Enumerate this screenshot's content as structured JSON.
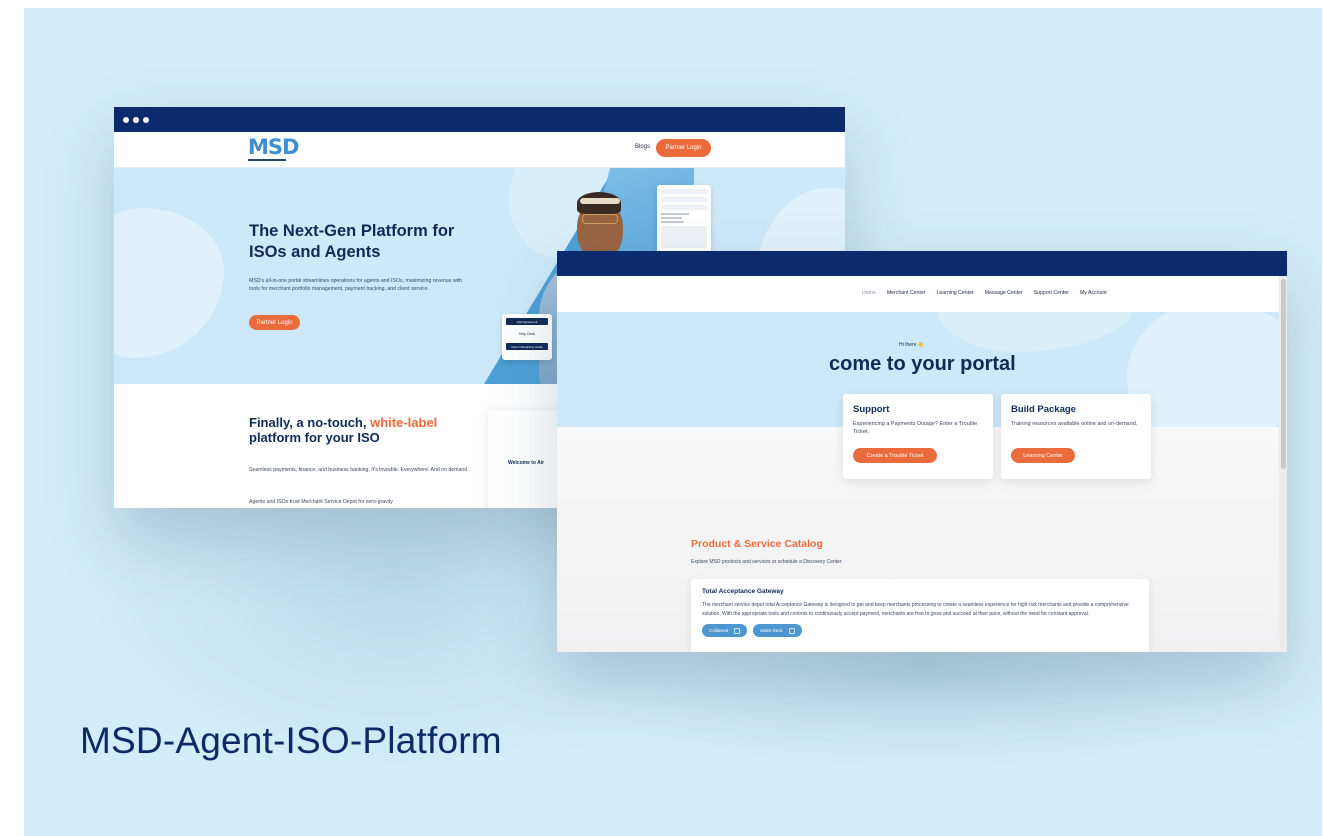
{
  "project": {
    "title": "MSD-Agent-ISO-Platform"
  },
  "landing": {
    "logo": "MSD",
    "nav": {
      "blogs": "Blogs",
      "login": "Partner Login"
    },
    "hero": {
      "title": "The Next-Gen Platform for ISOs and Agents",
      "description": "MSD's all-in-one portal streamlines operations for agents and ISOs, maximizing revenue with tools for merchant portfolio management, payment tracking, and client service.",
      "cta": "Partner Login"
    },
    "mini_card": {
      "button1": "Add Agreement",
      "text": "Help Desk",
      "button2": "View Onboarding Guide"
    },
    "section2": {
      "title_part1": "Finally, a no-touch, ",
      "title_accent": "white-label",
      "title_part2": " platform for your ISO",
      "desc1": "Seamless payments, finance, and business banking. It's invisible. Everywhere. And on demand.",
      "desc2": "Agents and ISOs trust Merchant Service Depot for zero-gravity",
      "video_label": "Welcome to Air"
    }
  },
  "portal": {
    "nav": [
      "Home",
      "Merchant Center",
      "Learning Center",
      "Message Center",
      "Support Center",
      "My Account"
    ],
    "greeting": "Hi there 👋",
    "welcome": "come to your portal",
    "tiles": [
      {
        "title": "Support",
        "desc": "Experiencing a Payments Outage? Enter a Trouble Ticket.",
        "button": "Create a Trouble Ticket"
      },
      {
        "title": "Build Package",
        "desc": "Training resources available online and on-demand.",
        "button": "Learning Center"
      }
    ],
    "catalog": {
      "title": "Product & Service Catalog",
      "desc": "Explore MSD products and services or schedule a Discovery Center.",
      "item": {
        "title": "Total Acceptance Gateway",
        "desc": "The merchant service depot total Acceptance Gateway is designed to get and keep merchants processing to create a seamless experience for high-risk merchants and provide a comprehensive solution. With the appropriate tools and controls to continuously accept payment, merchants are free to grow and succeed at their pace, without the need for constant approval.",
        "buttons": [
          "Collateral",
          "Sales Deck"
        ]
      }
    }
  },
  "colors": {
    "navy": "#0b2b6e",
    "orange": "#ea6b3b",
    "sky": "#cde8f8",
    "background": "#d2ecf9"
  }
}
